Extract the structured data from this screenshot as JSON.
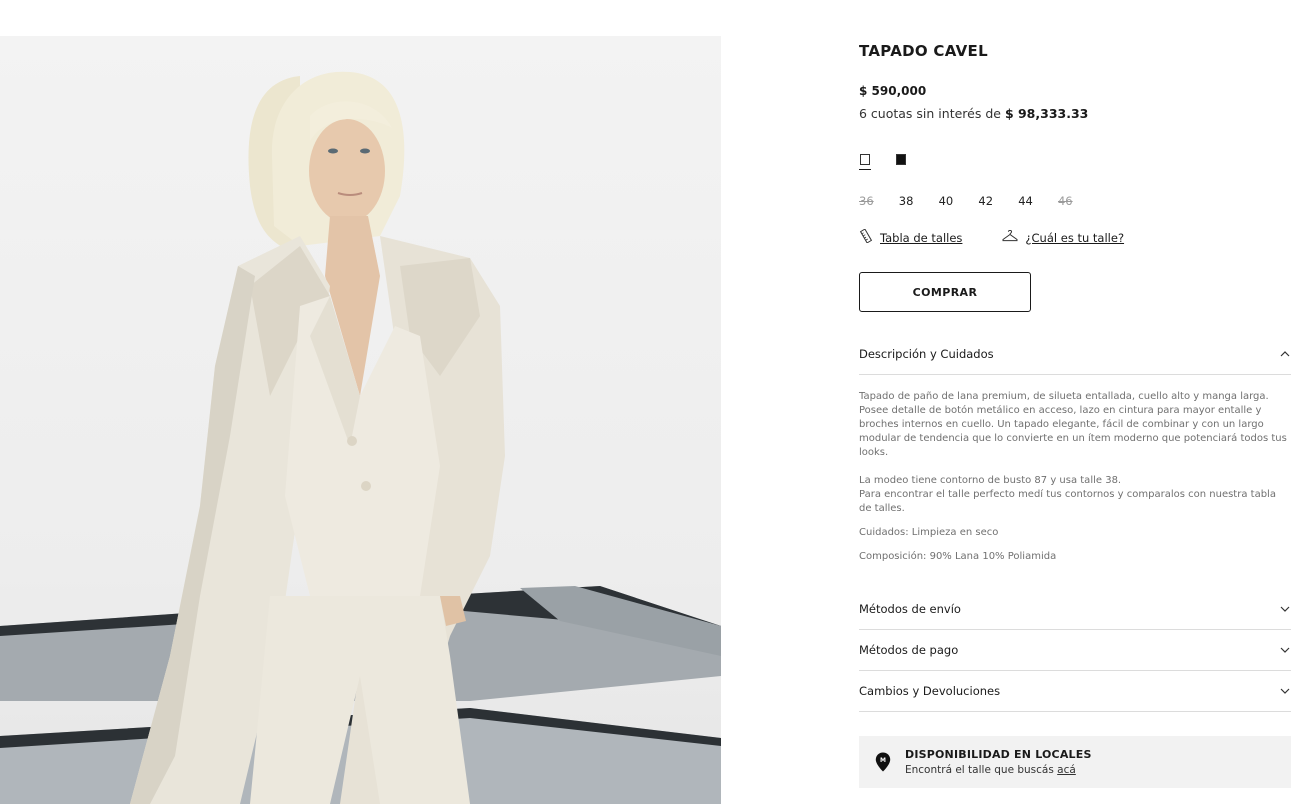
{
  "product": {
    "title": "TAPADO CAVEL",
    "price": "$ 590,000",
    "installments_prefix": "6 cuotas sin interés de ",
    "installments_amount": "$ 98,333.33"
  },
  "colors": [
    {
      "name": "white-swatch",
      "hex": "#ffffff",
      "selected": true
    },
    {
      "name": "black-swatch",
      "hex": "#111111",
      "selected": false
    }
  ],
  "sizes": [
    {
      "label": "36",
      "available": false
    },
    {
      "label": "38",
      "available": true
    },
    {
      "label": "40",
      "available": true
    },
    {
      "label": "42",
      "available": true
    },
    {
      "label": "44",
      "available": true
    },
    {
      "label": "46",
      "available": false
    }
  ],
  "size_links": {
    "chart_label": "Tabla de talles",
    "chart_icon": "ruler-icon",
    "finder_label": "¿Cuál es tu talle?",
    "finder_icon": "hanger-icon"
  },
  "buy_button": "COMPRAR",
  "accordion": {
    "description": {
      "title": "Descripción y Cuidados",
      "expanded": true,
      "paragraphs": [
        "Tapado de paño de lana premium, de silueta entallada, cuello alto y manga larga. Posee detalle de botón metálico en acceso, lazo en cintura para mayor entalle y broches internos en cuello. Un tapado elegante, fácil de combinar y con un largo modular de tendencia que lo convierte en un ítem moderno que potenciará todos tus looks.",
        "La modeo tiene contorno de busto 87 y usa talle 38.",
        "Para encontrar el talle perfecto medí tus contornos y comparalos con nuestra tabla de talles.",
        "Cuidados: Limpieza en seco",
        "Composición: 90% Lana 10% Poliamida"
      ]
    },
    "shipping": {
      "title": "Métodos de envío",
      "expanded": false
    },
    "payment": {
      "title": "Métodos de pago",
      "expanded": false
    },
    "returns": {
      "title": "Cambios y Devoluciones",
      "expanded": false
    }
  },
  "stores": {
    "icon": "map-pin-icon",
    "pin_letter": "M",
    "title": "DISPONIBILIDAD EN LOCALES",
    "subtitle_prefix": "Encontrá el talle que buscás ",
    "subtitle_link": "acá"
  },
  "colors_theme": {
    "text": "#1a1a1a",
    "muted": "#707070",
    "divider": "#dcdcdc",
    "stores_bg": "#f2f2f2"
  }
}
